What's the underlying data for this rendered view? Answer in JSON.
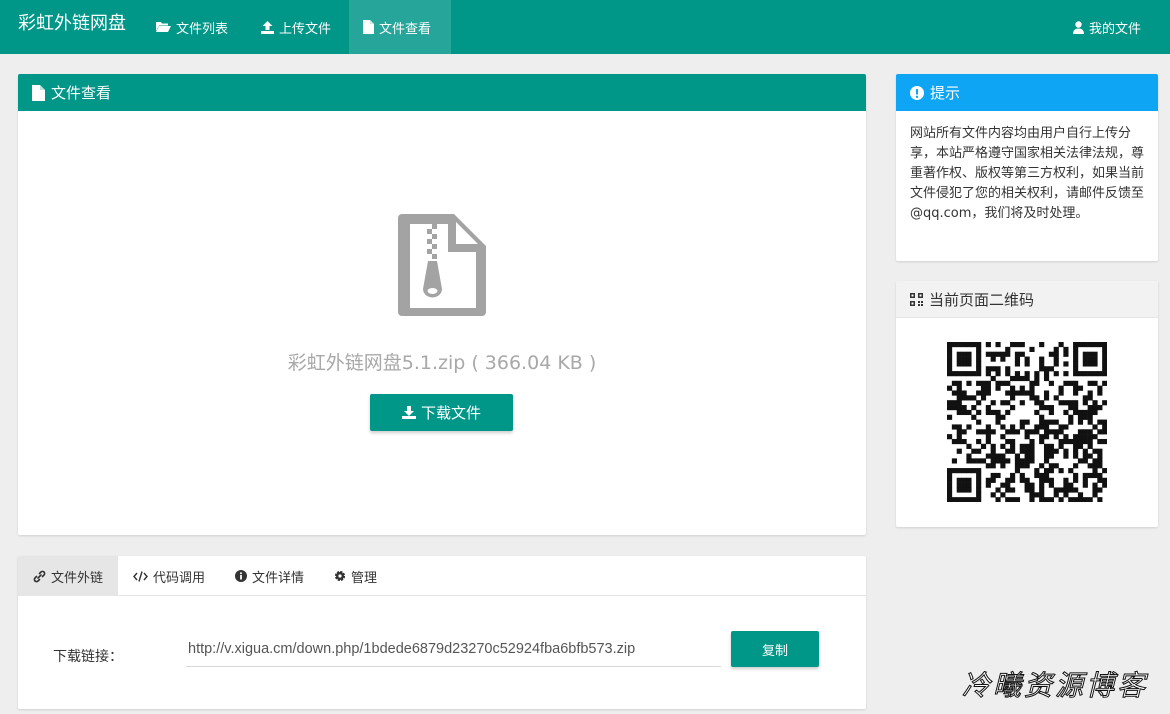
{
  "navbar": {
    "brand": "彩虹外链网盘",
    "items": [
      {
        "label": "文件列表",
        "icon": "folder-open-icon"
      },
      {
        "label": "上传文件",
        "icon": "upload-icon"
      },
      {
        "label": "文件查看",
        "icon": "file-icon",
        "active": true
      }
    ],
    "user_label": "我的文件",
    "user_icon": "user-icon"
  },
  "viewer": {
    "title": "文件查看",
    "file_name": "彩虹外链网盘5.1.zip",
    "file_size": "366.04 KB",
    "file_display": "彩虹外链网盘5.1.zip ( 366.04 KB )",
    "download_label": "下载文件",
    "file_icon": "zip-file-icon"
  },
  "tip": {
    "title": "提示",
    "text": "网站所有文件内容均由用户自行上传分享，本站严格遵守国家相关法律法规，尊重著作权、版权等第三方权利，如果当前文件侵犯了您的相关权利，请邮件反馈至@qq.com，我们将及时处理。"
  },
  "qr": {
    "title": "当前页面二维码"
  },
  "tabs": [
    {
      "label": "文件外链",
      "icon": "link-icon",
      "active": true
    },
    {
      "label": "代码调用",
      "icon": "code-icon"
    },
    {
      "label": "文件详情",
      "icon": "info-icon"
    },
    {
      "label": "管理",
      "icon": "gear-icon"
    }
  ],
  "link": {
    "label": "下载链接：",
    "value": "http://v.xigua.cm/down.php/1bdede6879d23270c52924fba6bfb573.zip",
    "copy_label": "复制"
  },
  "watermark": "冷曦资源博客",
  "colors": {
    "primary": "#009688",
    "tip_header": "#0ea5f5",
    "background": "#eeeeee"
  }
}
